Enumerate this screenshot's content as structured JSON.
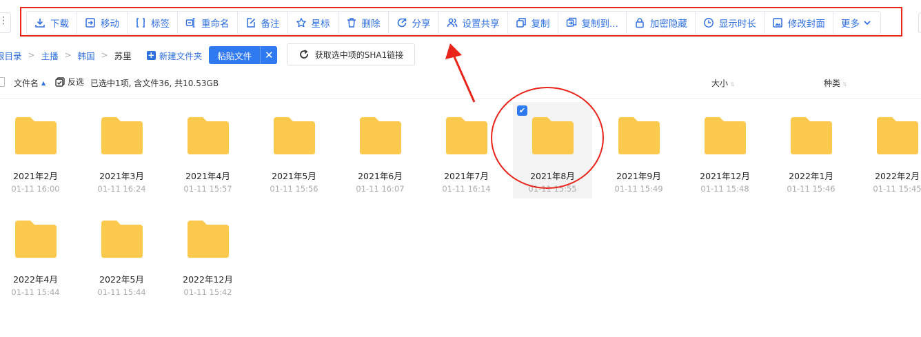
{
  "toolbar": {
    "buttons": [
      {
        "label": "下载",
        "icon": "download-icon"
      },
      {
        "label": "移动",
        "icon": "move-icon"
      },
      {
        "label": "标签",
        "icon": "tag-icon"
      },
      {
        "label": "重命名",
        "icon": "rename-icon"
      },
      {
        "label": "备注",
        "icon": "note-icon"
      },
      {
        "label": "星标",
        "icon": "star-icon"
      },
      {
        "label": "删除",
        "icon": "trash-icon"
      },
      {
        "label": "分享",
        "icon": "share-icon"
      },
      {
        "label": "设置共享",
        "icon": "users-icon"
      },
      {
        "label": "复制",
        "icon": "copy-icon"
      },
      {
        "label": "复制到...",
        "icon": "copy-to-icon"
      },
      {
        "label": "加密隐藏",
        "icon": "lock-icon"
      },
      {
        "label": "显示时长",
        "icon": "clock-icon"
      },
      {
        "label": "修改封面",
        "icon": "image-icon"
      },
      {
        "label": "更多",
        "icon": "chevron-down-icon"
      }
    ]
  },
  "breadcrumb": {
    "items": [
      "根目录",
      "主播",
      "韩国",
      "苏里"
    ],
    "new_folder": "新建文件夹",
    "paste": "粘贴文件"
  },
  "sha1_button": "获取选中项的SHA1链接",
  "list_header": {
    "name": "文件名",
    "invert": "反选",
    "selection": "已选中1项, 含文件36, 共10.53GB",
    "size": "大小",
    "kind": "种类"
  },
  "folders": [
    {
      "name": "2021年2月",
      "time": "01-11 16:00",
      "selected": false
    },
    {
      "name": "2021年3月",
      "time": "01-11 16:24",
      "selected": false
    },
    {
      "name": "2021年4月",
      "time": "01-11 15:57",
      "selected": false
    },
    {
      "name": "2021年5月",
      "time": "01-11 15:56",
      "selected": false
    },
    {
      "name": "2021年6月",
      "time": "01-11 16:07",
      "selected": false
    },
    {
      "name": "2021年7月",
      "time": "01-11 16:14",
      "selected": false
    },
    {
      "name": "2021年8月",
      "time": "01-11 15:55",
      "selected": true
    },
    {
      "name": "2021年9月",
      "time": "01-11 15:49",
      "selected": false
    },
    {
      "name": "2021年12月",
      "time": "01-11 15:48",
      "selected": false
    },
    {
      "name": "2022年1月",
      "time": "01-11 15:46",
      "selected": false
    },
    {
      "name": "2022年2月",
      "time": "01-11 15:45",
      "selected": false
    },
    {
      "name": "2022年4月",
      "time": "01-11 15:44",
      "selected": false
    },
    {
      "name": "2022年5月",
      "time": "01-11 15:44",
      "selected": false
    },
    {
      "name": "2022年12月",
      "time": "01-11 15:42",
      "selected": false
    }
  ],
  "colors": {
    "accent": "#2f6fe0",
    "folder": "#fcc94f",
    "annotation": "#e8241b"
  }
}
